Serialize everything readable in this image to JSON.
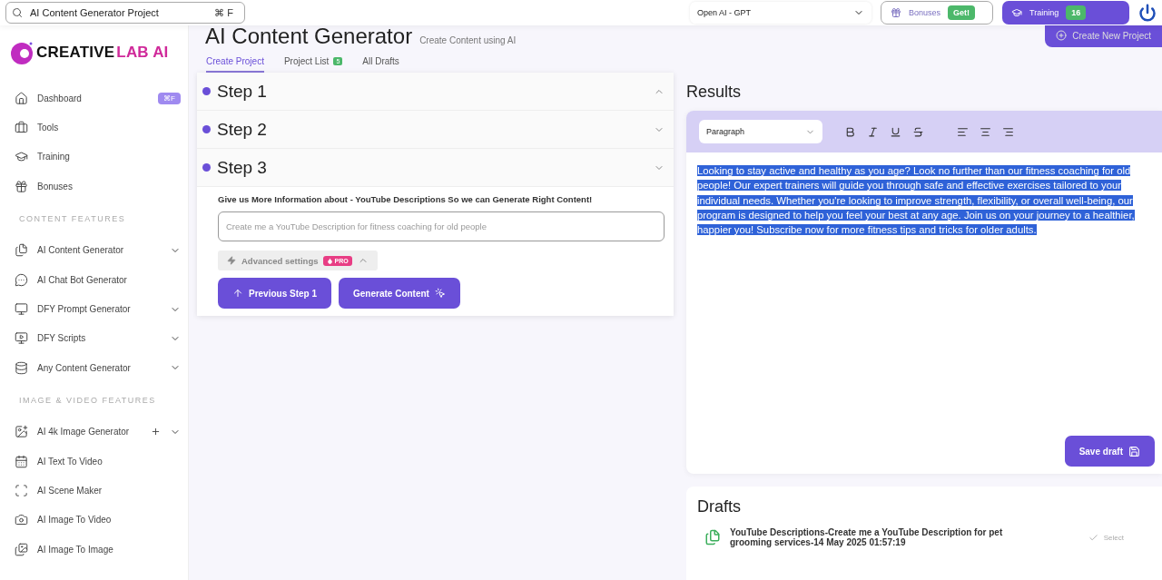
{
  "topbar": {
    "search": {
      "value": "AI Content Generator Project",
      "shortcut": "⌘ F"
    },
    "model_select": {
      "value": "Open AI - GPT"
    },
    "bonuses": {
      "label": "Bonuses",
      "badge": "Get!"
    },
    "training": {
      "label": "Training",
      "badge": "16"
    }
  },
  "sidebar": {
    "logo": {
      "first": "CREATIVE",
      "second": "LAB AI"
    },
    "groups": [
      {
        "items": [
          {
            "label": "Dashboard",
            "badge": "⌘F",
            "chevron": false,
            "plus": false
          },
          {
            "label": "Tools",
            "chevron": false,
            "plus": false
          },
          {
            "label": "Training",
            "chevron": false,
            "plus": false
          },
          {
            "label": "Bonuses",
            "chevron": false,
            "plus": false
          }
        ]
      },
      {
        "heading": "CONTENT FEATURES",
        "items": [
          {
            "label": "AI Content Generator",
            "chevron": true,
            "plus": false
          },
          {
            "label": "AI Chat Bot Generator",
            "chevron": false,
            "plus": false
          },
          {
            "label": "DFY Prompt Generator",
            "chevron": true,
            "plus": false
          },
          {
            "label": "DFY Scripts",
            "chevron": true,
            "plus": false
          },
          {
            "label": "Any Content Generator",
            "chevron": true,
            "plus": false
          }
        ]
      },
      {
        "heading": "IMAGE & VIDEO FEATURES",
        "items": [
          {
            "label": "AI 4k Image Generator",
            "chevron": true,
            "plus": true
          },
          {
            "label": "AI Text To Video",
            "chevron": false,
            "plus": false
          },
          {
            "label": "AI Scene Maker",
            "chevron": false,
            "plus": false
          },
          {
            "label": "AI Image To Video",
            "chevron": false,
            "plus": false
          },
          {
            "label": "AI Image To Image",
            "chevron": false,
            "plus": false
          }
        ]
      }
    ]
  },
  "page": {
    "title": "AI Content Generator",
    "subtitle": "Create Content using AI",
    "create_button": "Create New Project",
    "tabs": [
      {
        "label": "Create Project",
        "selected": true
      },
      {
        "label": "Project List",
        "selected": false,
        "badge": "5"
      },
      {
        "label": "All Drafts",
        "selected": false
      }
    ]
  },
  "steps": [
    {
      "label": "Step 1",
      "expanded": true
    },
    {
      "label": "Step 2",
      "expanded": false
    },
    {
      "label": "Step 3",
      "expanded": false
    }
  ],
  "step_form": {
    "prompt": "Give us More Information about - YouTube Descriptions So we can Generate Right Content!",
    "placeholder": "Create me a YouTube Description for fitness coaching for old people",
    "advanced": {
      "label": "Advanced settings",
      "badge": "PRO",
      "expanded": true
    },
    "previous_button": "Previous Step 1",
    "generate_button": "Generate Content"
  },
  "results": {
    "title": "Results",
    "block_select": "Paragraph",
    "text": "Looking to stay active and healthy as you age? Look no further than our fitness coaching for old people! Our expert trainers will guide you through safe and effective exercises tailored to your individual needs. Whether you're looking to improve strength, flexibility, or overall well-being, our program is designed to help you feel your best at any age. Join us on your journey to a healthier, happier you! Subscribe now for more fitness tips and tricks for older adults.",
    "text_selected": true,
    "save_button": "Save draft"
  },
  "drafts": {
    "title": "Drafts",
    "items": [
      {
        "text": "YouTube Descriptions-Create me a YouTube Description for pet grooming services-14 May 2025 01:57:19",
        "action": "Select",
        "selected": false
      }
    ]
  }
}
